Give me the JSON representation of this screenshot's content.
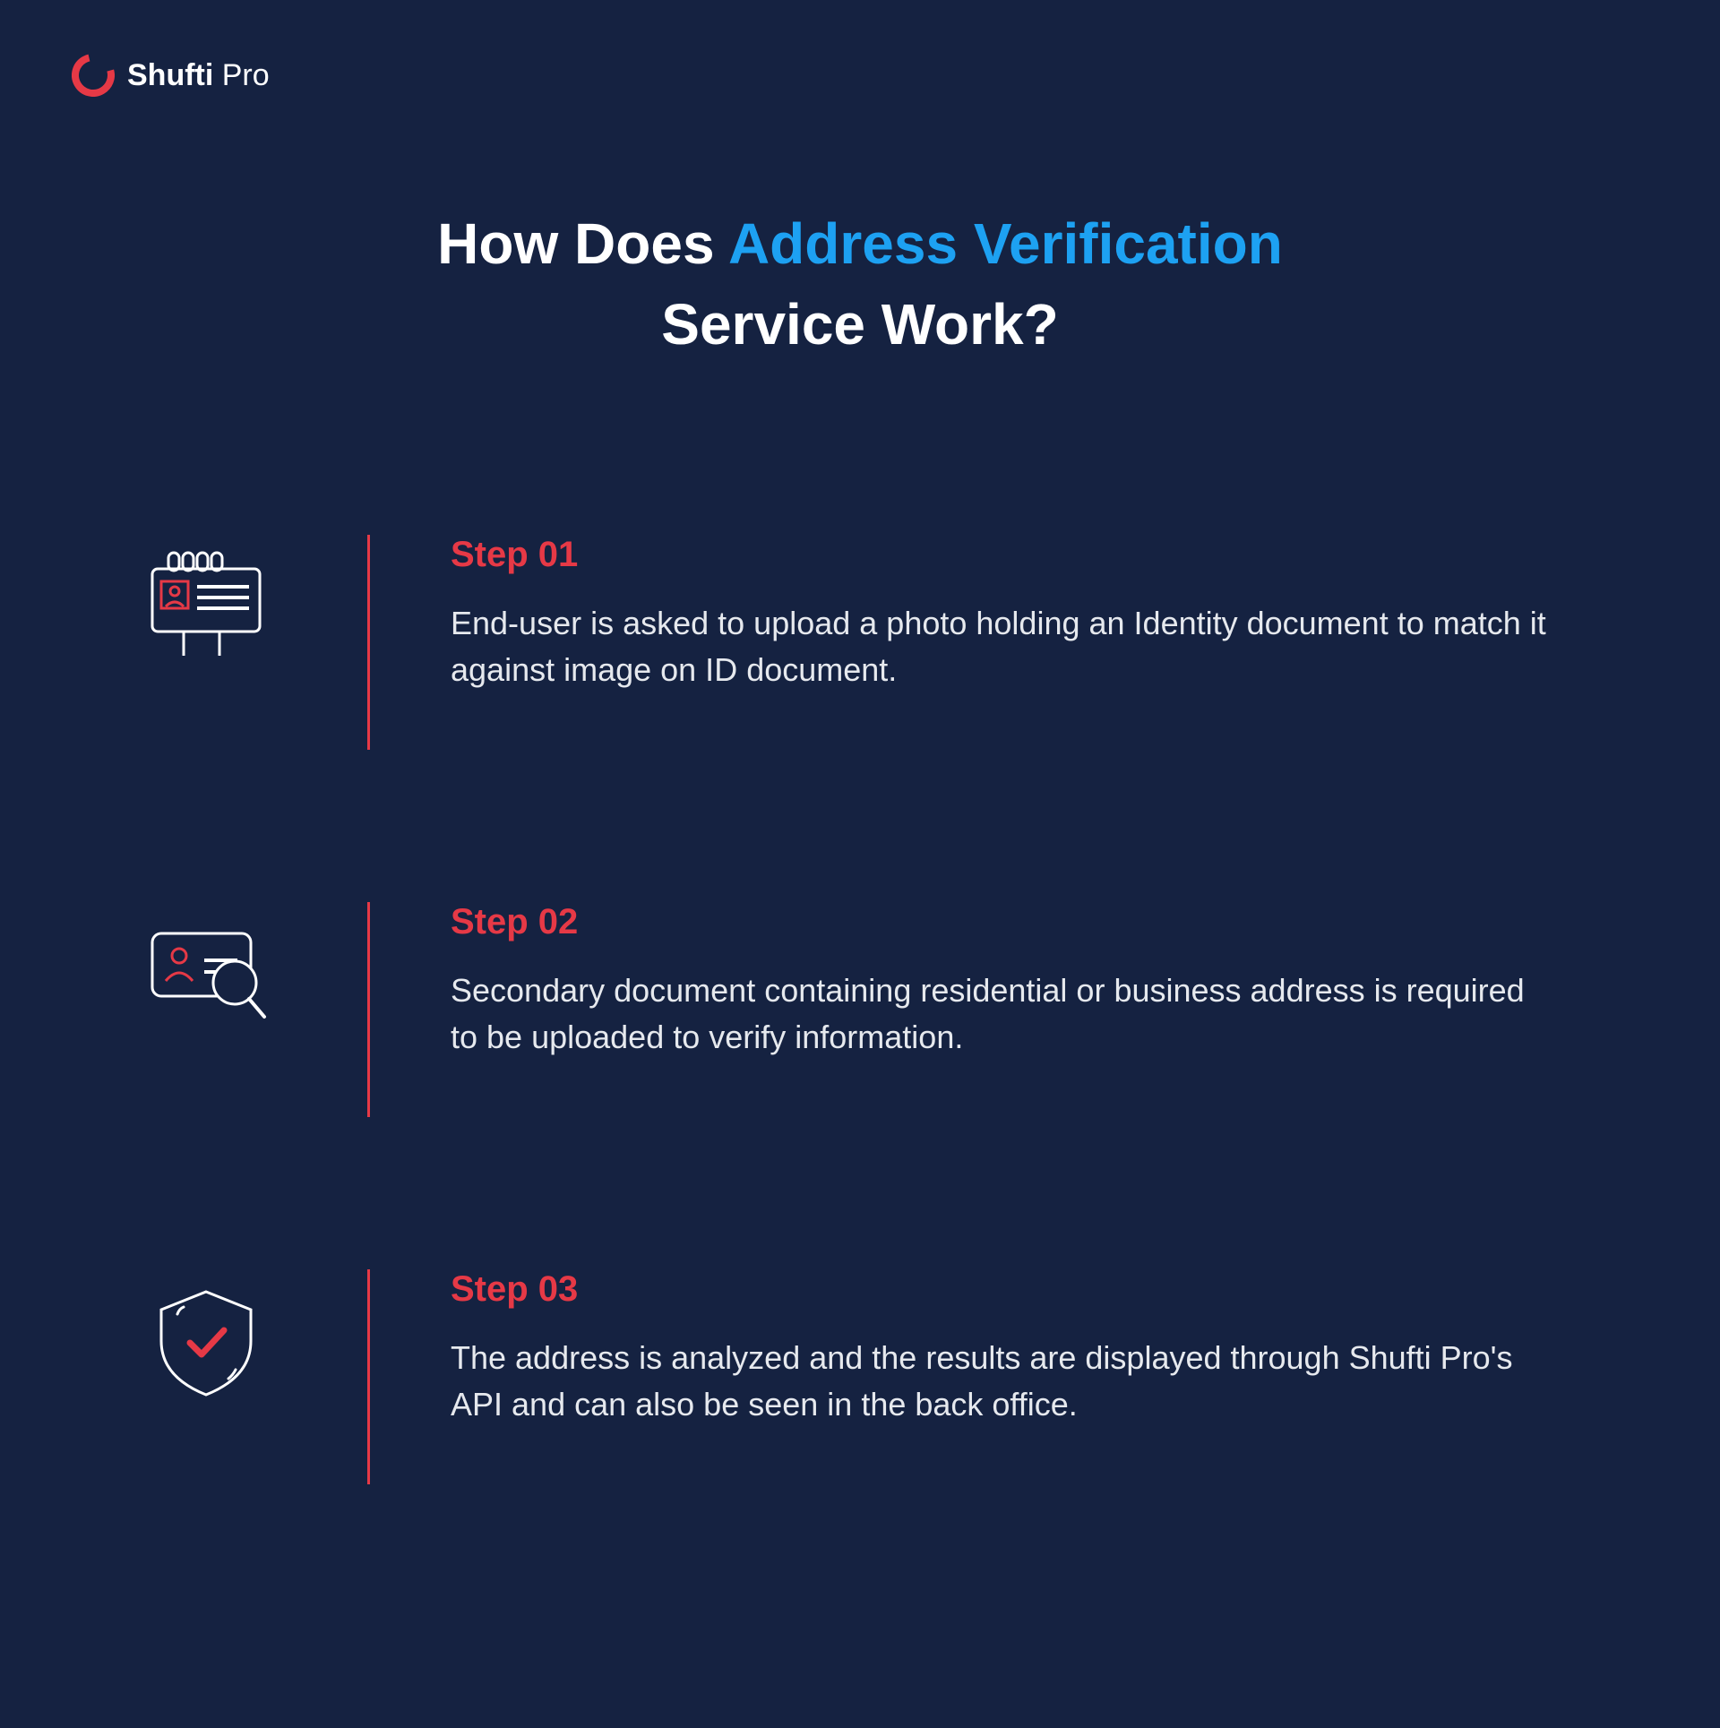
{
  "brand": {
    "name_bold": "Shufti",
    "name_light": " Pro"
  },
  "title": {
    "prefix": "How Does ",
    "accent": "Address Verification",
    "suffix": "Service Work?"
  },
  "colors": {
    "background": "#152241",
    "accent_red": "#e63946",
    "accent_blue": "#1da1f2",
    "text": "#ffffff"
  },
  "steps": [
    {
      "label": "Step 01",
      "description": "End-user is asked to upload a photo holding an Identity document to match it against image on ID document.",
      "icon": "id-held-icon"
    },
    {
      "label": "Step 02",
      "description": "Secondary document containing residential or business address is required to be uploaded to verify information.",
      "icon": "id-search-icon"
    },
    {
      "label": "Step 03",
      "description": "The address is analyzed and the results are displayed through Shufti Pro's API and can also be seen in the back office.",
      "icon": "shield-check-icon"
    }
  ]
}
